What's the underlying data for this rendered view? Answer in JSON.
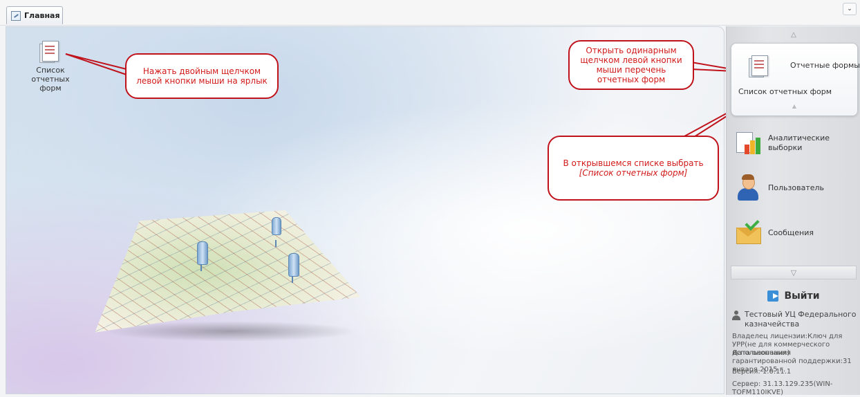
{
  "tabs": [
    {
      "label": "Главная"
    }
  ],
  "desktop": {
    "shortcut_label": "Список отчетных форм"
  },
  "callouts": {
    "desktop_hint": "Нажать двойным щелчком левой кнопки мыши на ярлык",
    "panel_hint": "Открыть одинарным щелчком левой кнопки мыши перечень отчетных форм",
    "list_hint_line1": "В открывшемся списке выбрать",
    "list_hint_line2": "[Список отчетных форм]"
  },
  "sidebar": {
    "items": [
      {
        "label": "Отчетные формы",
        "icon": "report-forms-icon",
        "subitems": [
          "Список отчетных форм"
        ]
      },
      {
        "label": "Аналитические выборки",
        "icon": "analytics-chart-icon"
      },
      {
        "label": "Пользователь",
        "icon": "user-icon"
      },
      {
        "label": "Сообщения",
        "icon": "messages-envelope-icon"
      }
    ],
    "logout_label": "Выйти"
  },
  "footer_info": {
    "user": "Тестовый УЦ Федерального казначейства",
    "license": "Владелец лицензии:Ключ для УРР(не для коммерческого использования)",
    "warranty": "Дата окончания гарантированной поддержки:31 января 2015 г.",
    "version": "Версия: 1.0.11.1",
    "server": "Сервер: 31.13.129.235(WIN-TOFM110IKVE)"
  },
  "colors": {
    "callout_border": "#c0121b",
    "callout_text": "#d21a1a"
  }
}
